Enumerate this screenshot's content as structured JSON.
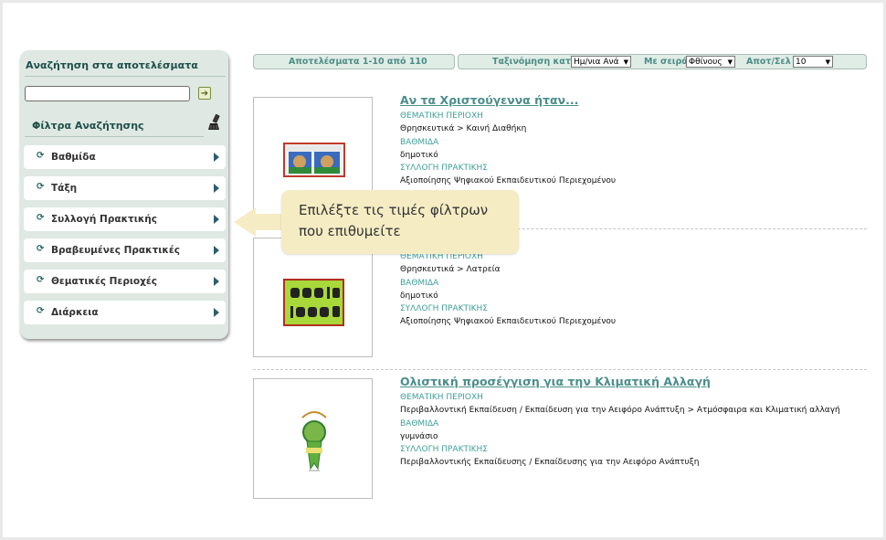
{
  "sidebar": {
    "search_title": "Αναζήτηση στα αποτελέσματα",
    "search_value": "",
    "go_icon": "arrow-right-box-icon",
    "filters_title": "Φίλτρα Αναζήτησης",
    "clear_icon": "brush-icon",
    "filters": [
      {
        "label": "Βαθμίδα"
      },
      {
        "label": "Τάξη"
      },
      {
        "label": "Συλλογή Πρακτικής"
      },
      {
        "label": "Βραβευμένες Πρακτικές"
      },
      {
        "label": "Θεματικές Περιοχές"
      },
      {
        "label": "Διάρκεια"
      }
    ]
  },
  "toolbar": {
    "results_label": "Αποτελέσματα 1-10 από 110",
    "sort_label": "Ταξινόμηση κατά",
    "sort_value": "Ημ/νια Ανά",
    "order_label": "Με σειρά",
    "order_value": "Φθίνους",
    "per_page_label": "Αποτ/Σελ",
    "per_page_value": "10"
  },
  "results": [
    {
      "title": "Αν τα Χριστούγεννα ήταν...",
      "label_area": "ΘΕΜΑΤΙΚΗ ΠΕΡΙΟΧΗ",
      "area": "Θρησκευτικά > Καινή Διαθήκη",
      "label_level": "ΒΑΘΜΙΔΑ",
      "level": "δημοτικό",
      "label_collection": "ΣΥΛΛΟΓΗ ΠΡΑΚΤΙΚΗΣ",
      "collection": "Αξιοποίησης Ψηφιακού Εκπαιδευτικού Περιεχομένου"
    },
    {
      "title": "",
      "label_area": "ΘΕΜΑΤΙΚΗ ΠΕΡΙΟΧΗ",
      "area": "Θρησκευτικά > Λατρεία",
      "label_level": "ΒΑΘΜΙΔΑ",
      "level": "δημοτικό",
      "label_collection": "ΣΥΛΛΟΓΗ ΠΡΑΚΤΙΚΗΣ",
      "collection": "Αξιοποίησης Ψηφιακού Εκπαιδευτικού Περιεχομένου"
    },
    {
      "title": "Ολιστική προσέγγιση για την Κλιματική Αλλαγή",
      "label_area": "ΘΕΜΑΤΙΚΗ ΠΕΡΙΟΧΗ",
      "area": "Περιβαλλοντική Εκπαίδευση / Εκπαίδευση για την Αειφόρο Ανάπτυξη > Ατμόσφαιρα και Κλιματική αλλαγή",
      "label_level": "ΒΑΘΜΙΔΑ",
      "level": "γυμνάσιο",
      "label_collection": "ΣΥΛΛΟΓΗ ΠΡΑΚΤΙΚΗΣ",
      "collection": "Περιβαλλοντικής Εκπαίδευσης / Εκπαίδευσης για την Αειφόρο Ανάπτυξη"
    }
  ],
  "callout": {
    "text": "Επιλέξτε τις τιμές φίλτρων που επιθυμείτε"
  }
}
